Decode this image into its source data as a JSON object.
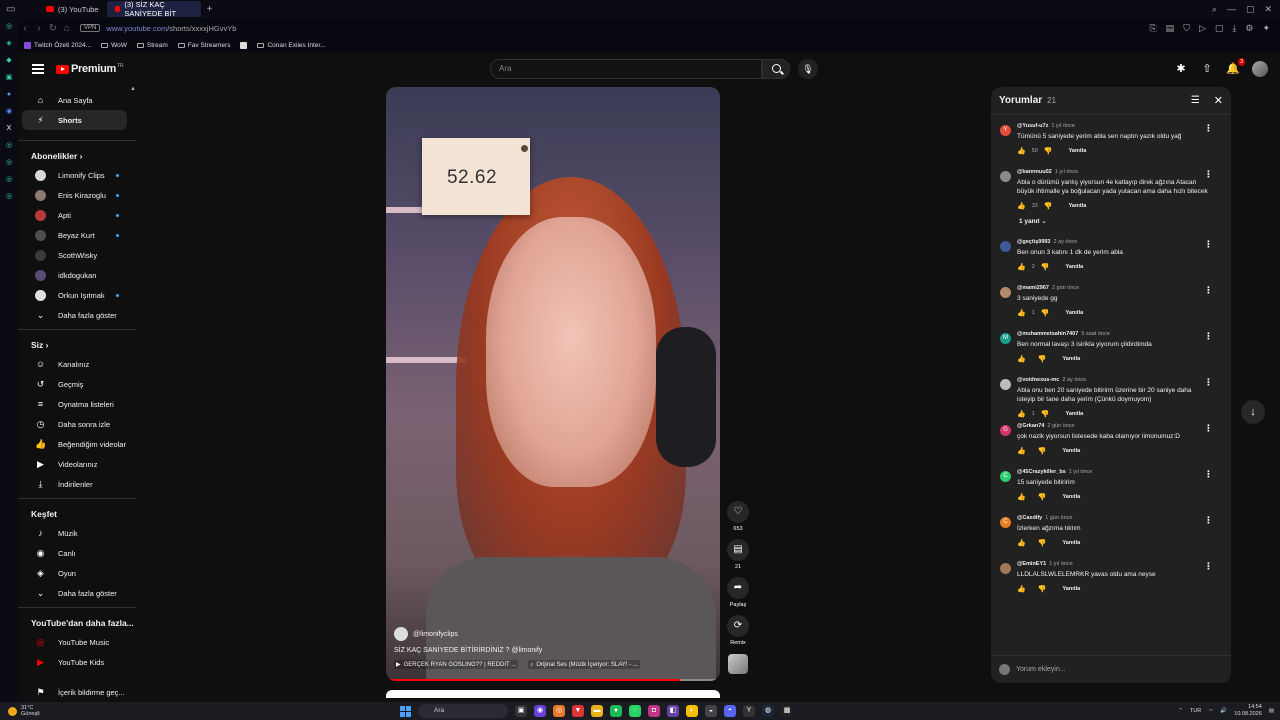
{
  "browser": {
    "tabs": [
      {
        "label": "(3) YouTube",
        "active": false
      },
      {
        "label": "(3) SİZ KAÇ SANİYEDE BİT",
        "active": true
      }
    ],
    "url_host": "www.youtube.com",
    "url_path": "/shorts/xxxxjHGvvYb",
    "secure_chip": "VPN",
    "bookmarks": [
      {
        "label": "Twitch Özeti 2024...",
        "icon": "bookmark-app-icon"
      },
      {
        "label": "WoW",
        "icon": "folder-icon"
      },
      {
        "label": "Stream",
        "icon": "folder-icon"
      },
      {
        "label": "Fav Streamers",
        "icon": "folder-icon"
      },
      {
        "label": "",
        "icon": "bookmark-app-icon"
      },
      {
        "label": "Conan Exiles Inter...",
        "icon": "folder-icon"
      }
    ]
  },
  "masthead": {
    "logo_text": "Premium",
    "logo_tr": "TR",
    "search_placeholder": "Ara",
    "notification_count": "3"
  },
  "nav": {
    "main": [
      {
        "label": "Ana Sayfa",
        "icon": "home-icon"
      },
      {
        "label": "Shorts",
        "icon": "shorts-icon",
        "active": true
      }
    ],
    "subs_title": "Abonelikler",
    "subs": [
      {
        "label": "Limonify Clips",
        "color": "#d9d9d9",
        "dot": true
      },
      {
        "label": "Enis Kirazoglu",
        "color": "#8c7a6e",
        "dot": true
      },
      {
        "label": "Apti",
        "color": "#b63a3a",
        "dot": true
      },
      {
        "label": "Beyaz Kurt",
        "color": "#4e4e4e",
        "dot": true
      },
      {
        "label": "ScothWisky",
        "color": "#3b3b3b",
        "dot": false
      },
      {
        "label": "idkdogukan",
        "color": "#5a4a78",
        "dot": false
      },
      {
        "label": "Orkun Işıtmak",
        "color": "#e0e0e0",
        "dot": true
      }
    ],
    "subs_more": "Daha fazla göster",
    "you_title": "Siz",
    "you": [
      {
        "label": "Kanalınız",
        "icon": "account-icon"
      },
      {
        "label": "Geçmiş",
        "icon": "history-icon"
      },
      {
        "label": "Oynatma listeleri",
        "icon": "playlists-icon"
      },
      {
        "label": "Daha sonra izle",
        "icon": "watch-later-icon"
      },
      {
        "label": "Beğendiğim videolar",
        "icon": "liked-icon"
      },
      {
        "label": "Videolarınız",
        "icon": "your-videos-icon"
      },
      {
        "label": "İndirilenler",
        "icon": "download-icon"
      }
    ],
    "explore_title": "Keşfet",
    "explore": [
      {
        "label": "Müzik",
        "icon": "music-icon"
      },
      {
        "label": "Canlı",
        "icon": "live-icon"
      },
      {
        "label": "Oyun",
        "icon": "gaming-icon"
      },
      {
        "label": "Daha fazla göster",
        "icon": "chevron-down-icon"
      }
    ],
    "more_title": "YouTube'dan daha fazla...",
    "more": [
      {
        "label": "YouTube Music",
        "icon": "youtube-music-icon"
      },
      {
        "label": "YouTube Kids",
        "icon": "youtube-kids-icon"
      }
    ],
    "bottom_item": "İçerik bildirme geç..."
  },
  "video": {
    "timer_value": "52.62",
    "channel": "@limonifyclips",
    "title": "SİZ KAÇ SANİYEDE BİTİRİRDİNİZ ? @limonify",
    "link1": "GERÇEK RYAN GOSLING?? | REDDIT ...",
    "link2": "Orijinal Ses (Müzik İçeriyor: SLAY! - ...",
    "progress": 0.88
  },
  "rail": {
    "likes": "653",
    "comments": "21",
    "share": "Paylaş",
    "remix": "Remix"
  },
  "comments_panel": {
    "title": "Yorumlar",
    "count": "21",
    "reply_label": "Yanıtla",
    "input_placeholder": "Yorum ekleyin...",
    "items": [
      {
        "user": "@Yusuf-u7z",
        "time": "1 yıl önce",
        "text": "Tümünü 5 saniyede yerim abla sen naptın yazık oldu yağ",
        "likes": "50",
        "avatar": "Y",
        "color": "#e74c3c"
      },
      {
        "user": "@bannnuu02",
        "time": "1 yıl önce",
        "text": "Abla o dürümü yanlış yiyorsun 4e katlayıp direk ağzına Atacan büyük ihtimalle ya boğulacan yada yutacan ama daha hızlı bitecek",
        "likes": "33",
        "avatar": "",
        "color": "#8a8a8a",
        "replies": "1 yanıt"
      },
      {
        "user": "@geçtiş9993",
        "time": "2 ay önce",
        "text": "Ben onun 3 katını 1 dk de yerim abla",
        "likes": "2",
        "avatar": "",
        "color": "#3d5a99"
      },
      {
        "user": "@mami2967",
        "time": "2 gün önce",
        "text": "3 saniyede gg",
        "likes": "1",
        "avatar": "",
        "color": "#b58a6a"
      },
      {
        "user": "@muhammetsahin7407",
        "time": "5 saat önce",
        "text": "Ben normal lavaşı 3 isirikla yiyorum çildirdimda",
        "likes": "",
        "avatar": "M",
        "color": "#16a085"
      },
      {
        "user": "@voidnexus-mc",
        "time": "2 ay önce",
        "text": "Abla onu ben 20 saniyede bitirirm üzerine bir 20 saniye daha isteyip bir tane daha yerim (Çünkü doymuyom)",
        "likes": "1",
        "avatar": "",
        "color": "#bbbbbb"
      },
      {
        "user": "@Grkan74",
        "time": "2 gün önce",
        "text": "çok nazik yiyorsun listesede kaba olamıyor limonumuz:D",
        "likes": "",
        "avatar": "G",
        "color": "#d6336c"
      },
      {
        "user": "@45Crazykiller_bs",
        "time": "1 yıl önce",
        "text": "15 saniyede bitiririm",
        "likes": "",
        "avatar": "C",
        "color": "#2ecc71"
      },
      {
        "user": "@Caxdify",
        "time": "1 gün önce",
        "text": "İzlerken ağzıma tıktım",
        "likes": "",
        "avatar": "C",
        "color": "#e67e22"
      },
      {
        "user": "@EminEY1",
        "time": "1 yıl önce",
        "text": "LLDLALSLWLELEMRKR yavas oldu ama neyse",
        "likes": "",
        "avatar": "",
        "color": "#a0785a"
      }
    ]
  },
  "taskbar": {
    "temp": "31°C",
    "weather": "Güneşli",
    "search": "Ara",
    "lang": "TUR",
    "time": "14:54",
    "date": "10.08.2026"
  }
}
